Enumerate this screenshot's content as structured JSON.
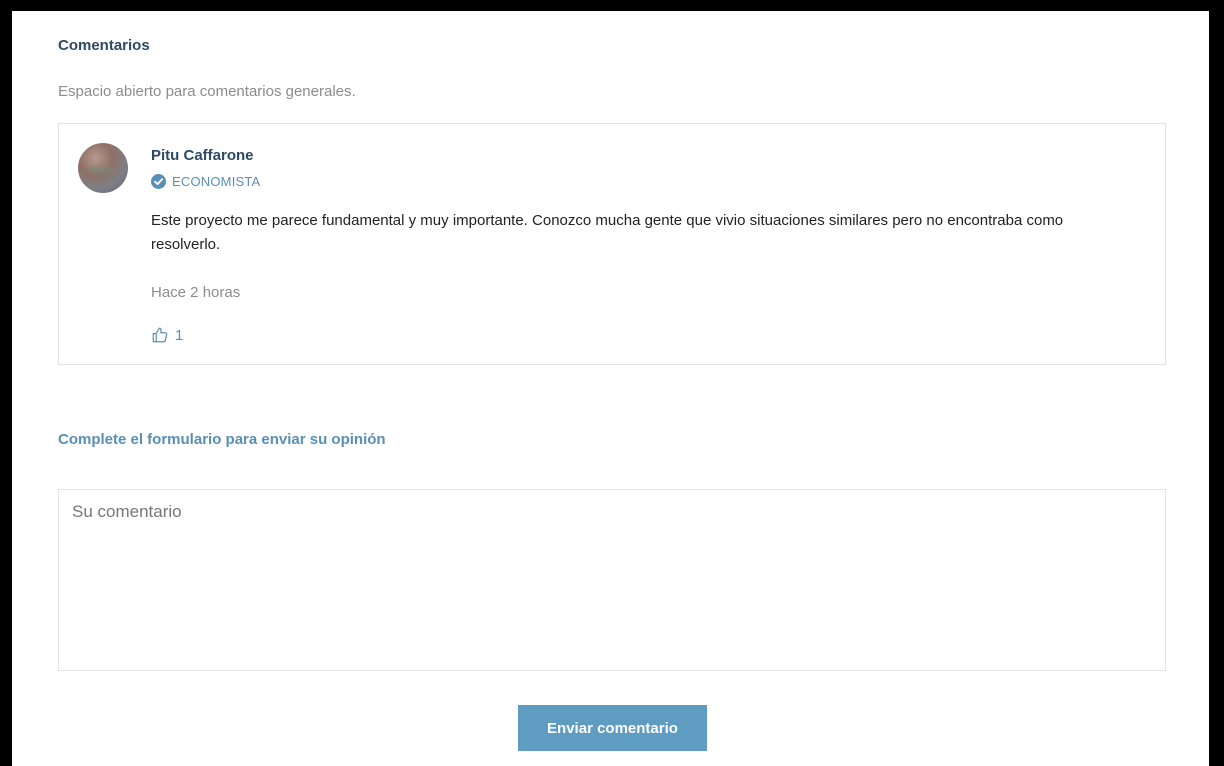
{
  "comments_section": {
    "title": "Comentarios",
    "subtitle": "Espacio abierto para comentarios generales."
  },
  "comment": {
    "author": "Pitu Caffarone",
    "badge": "ECONOMISTA",
    "text": "Este proyecto me parece fundamental y muy importante. Conozco mucha gente que vivio situaciones similares pero no encontraba como resolverlo.",
    "time": "Hace 2 horas",
    "likes": "1"
  },
  "form": {
    "title": "Complete el formulario para enviar su opinión",
    "placeholder": "Su comentario",
    "value": "",
    "submit_label": "Enviar comentario"
  },
  "colors": {
    "heading": "#2e4a63",
    "accent": "#5a8fb5",
    "button": "#5e9cc2"
  },
  "icons": {
    "verified": "check-circle-icon",
    "like": "thumbs-up-icon"
  }
}
